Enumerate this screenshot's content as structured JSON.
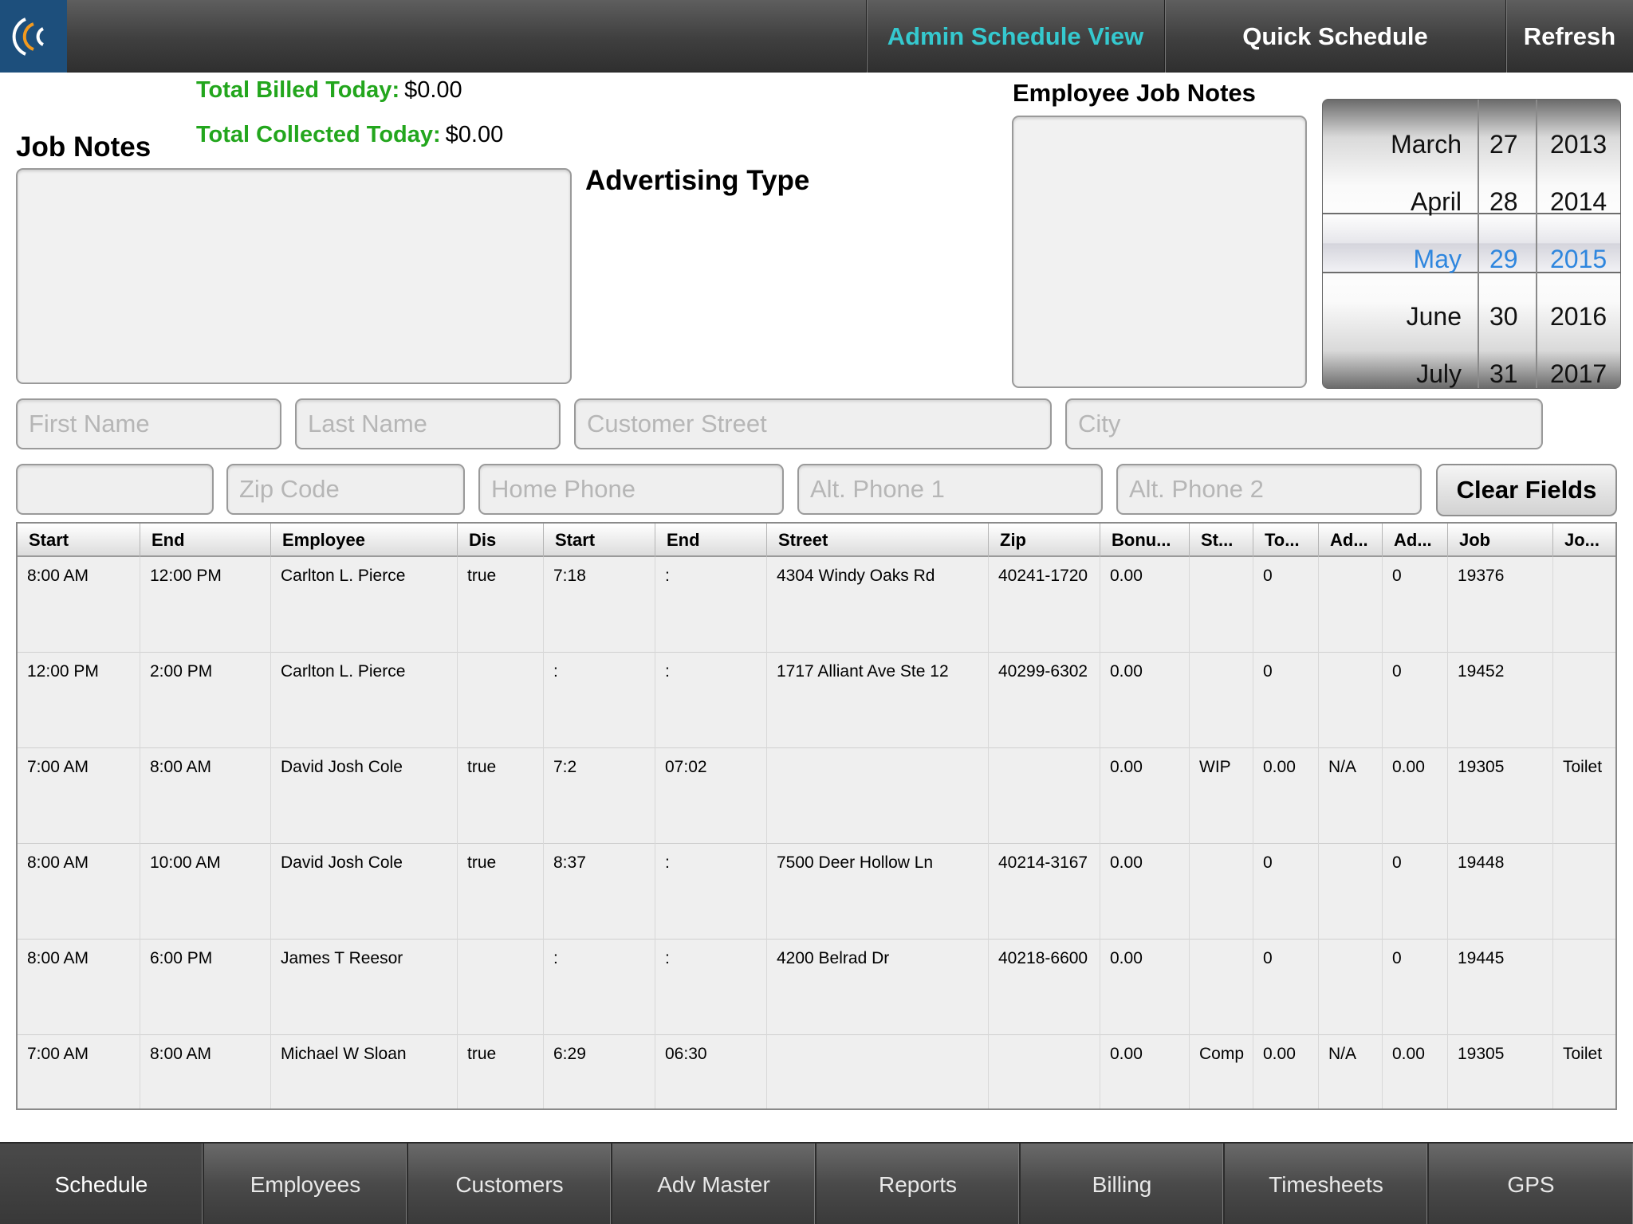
{
  "topbar": {
    "logo_icon": "company-logo",
    "buttons": [
      "Admin Schedule View",
      "Quick Schedule",
      "Refresh"
    ],
    "active_color": "#35c9cf"
  },
  "stats": {
    "billed_label": "Total Billed Today:",
    "billed_value": "$0.00",
    "collected_label": "Total Collected Today:",
    "collected_value": "$0.00"
  },
  "sections": {
    "job_notes": "Job Notes",
    "advertising_type": "Advertising Type",
    "employee_job_notes": "Employee Job Notes"
  },
  "date_picker": {
    "months": [
      "March",
      "April",
      "May",
      "June",
      "July"
    ],
    "days": [
      "27",
      "28",
      "29",
      "30",
      "31"
    ],
    "years": [
      "2013",
      "2014",
      "2015",
      "2016",
      "2017"
    ],
    "selected_index": 2,
    "selected_color": "#2e86de"
  },
  "form": {
    "first_name": {
      "placeholder": "First Name",
      "value": ""
    },
    "last_name": {
      "placeholder": "Last Name",
      "value": ""
    },
    "street": {
      "placeholder": "Customer Street",
      "value": ""
    },
    "city": {
      "placeholder": "City",
      "value": ""
    },
    "state": {
      "placeholder": "",
      "value": ""
    },
    "zip": {
      "placeholder": "Zip Code",
      "value": ""
    },
    "home_phone": {
      "placeholder": "Home Phone",
      "value": ""
    },
    "alt_phone_1": {
      "placeholder": "Alt. Phone 1",
      "value": ""
    },
    "alt_phone_2": {
      "placeholder": "Alt. Phone 2",
      "value": ""
    },
    "clear_label": "Clear Fields"
  },
  "table": {
    "headers": [
      "Start",
      "End",
      "Employee",
      "Dis",
      "Start",
      "End",
      "Street",
      "Zip",
      "Bonu...",
      "St...",
      "To...",
      "Ad...",
      "Ad...",
      "Job",
      "Jo..."
    ],
    "rows": [
      [
        "8:00 AM",
        "12:00 PM",
        "Carlton L. Pierce",
        "true",
        "7:18",
        ":",
        "4304 Windy Oaks Rd",
        "40241-1720",
        "0.00",
        "",
        "0",
        "",
        "0",
        "19376",
        ""
      ],
      [
        "12:00 PM",
        "2:00 PM",
        "Carlton L. Pierce",
        "",
        ":",
        ":",
        "1717 Alliant Ave Ste 12",
        "40299-6302",
        "0.00",
        "",
        "0",
        "",
        "0",
        "19452",
        ""
      ],
      [
        "7:00 AM",
        "8:00 AM",
        "David Josh Cole",
        "true",
        "7:2",
        "07:02",
        "",
        "",
        "0.00",
        "WIP",
        "0.00",
        "N/A",
        "0.00",
        "19305",
        "Toilet"
      ],
      [
        "8:00 AM",
        "10:00 AM",
        "David Josh Cole",
        "true",
        "8:37",
        ":",
        "7500 Deer Hollow Ln",
        "40214-3167",
        "0.00",
        "",
        "0",
        "",
        "0",
        "19448",
        ""
      ],
      [
        "8:00 AM",
        "6:00 PM",
        "James T Reesor",
        "",
        ":",
        ":",
        "4200 Belrad Dr",
        "40218-6600",
        "0.00",
        "",
        "0",
        "",
        "0",
        "19445",
        ""
      ],
      [
        "7:00 AM",
        "8:00 AM",
        "Michael W Sloan",
        "true",
        "6:29",
        "06:30",
        "",
        "",
        "0.00",
        "Comp",
        "0.00",
        "N/A",
        "0.00",
        "19305",
        "Toilet"
      ]
    ]
  },
  "tabs": [
    "Schedule",
    "Employees",
    "Customers",
    "Adv Master",
    "Reports",
    "Billing",
    "Timesheets",
    "GPS"
  ],
  "active_tab": 0
}
